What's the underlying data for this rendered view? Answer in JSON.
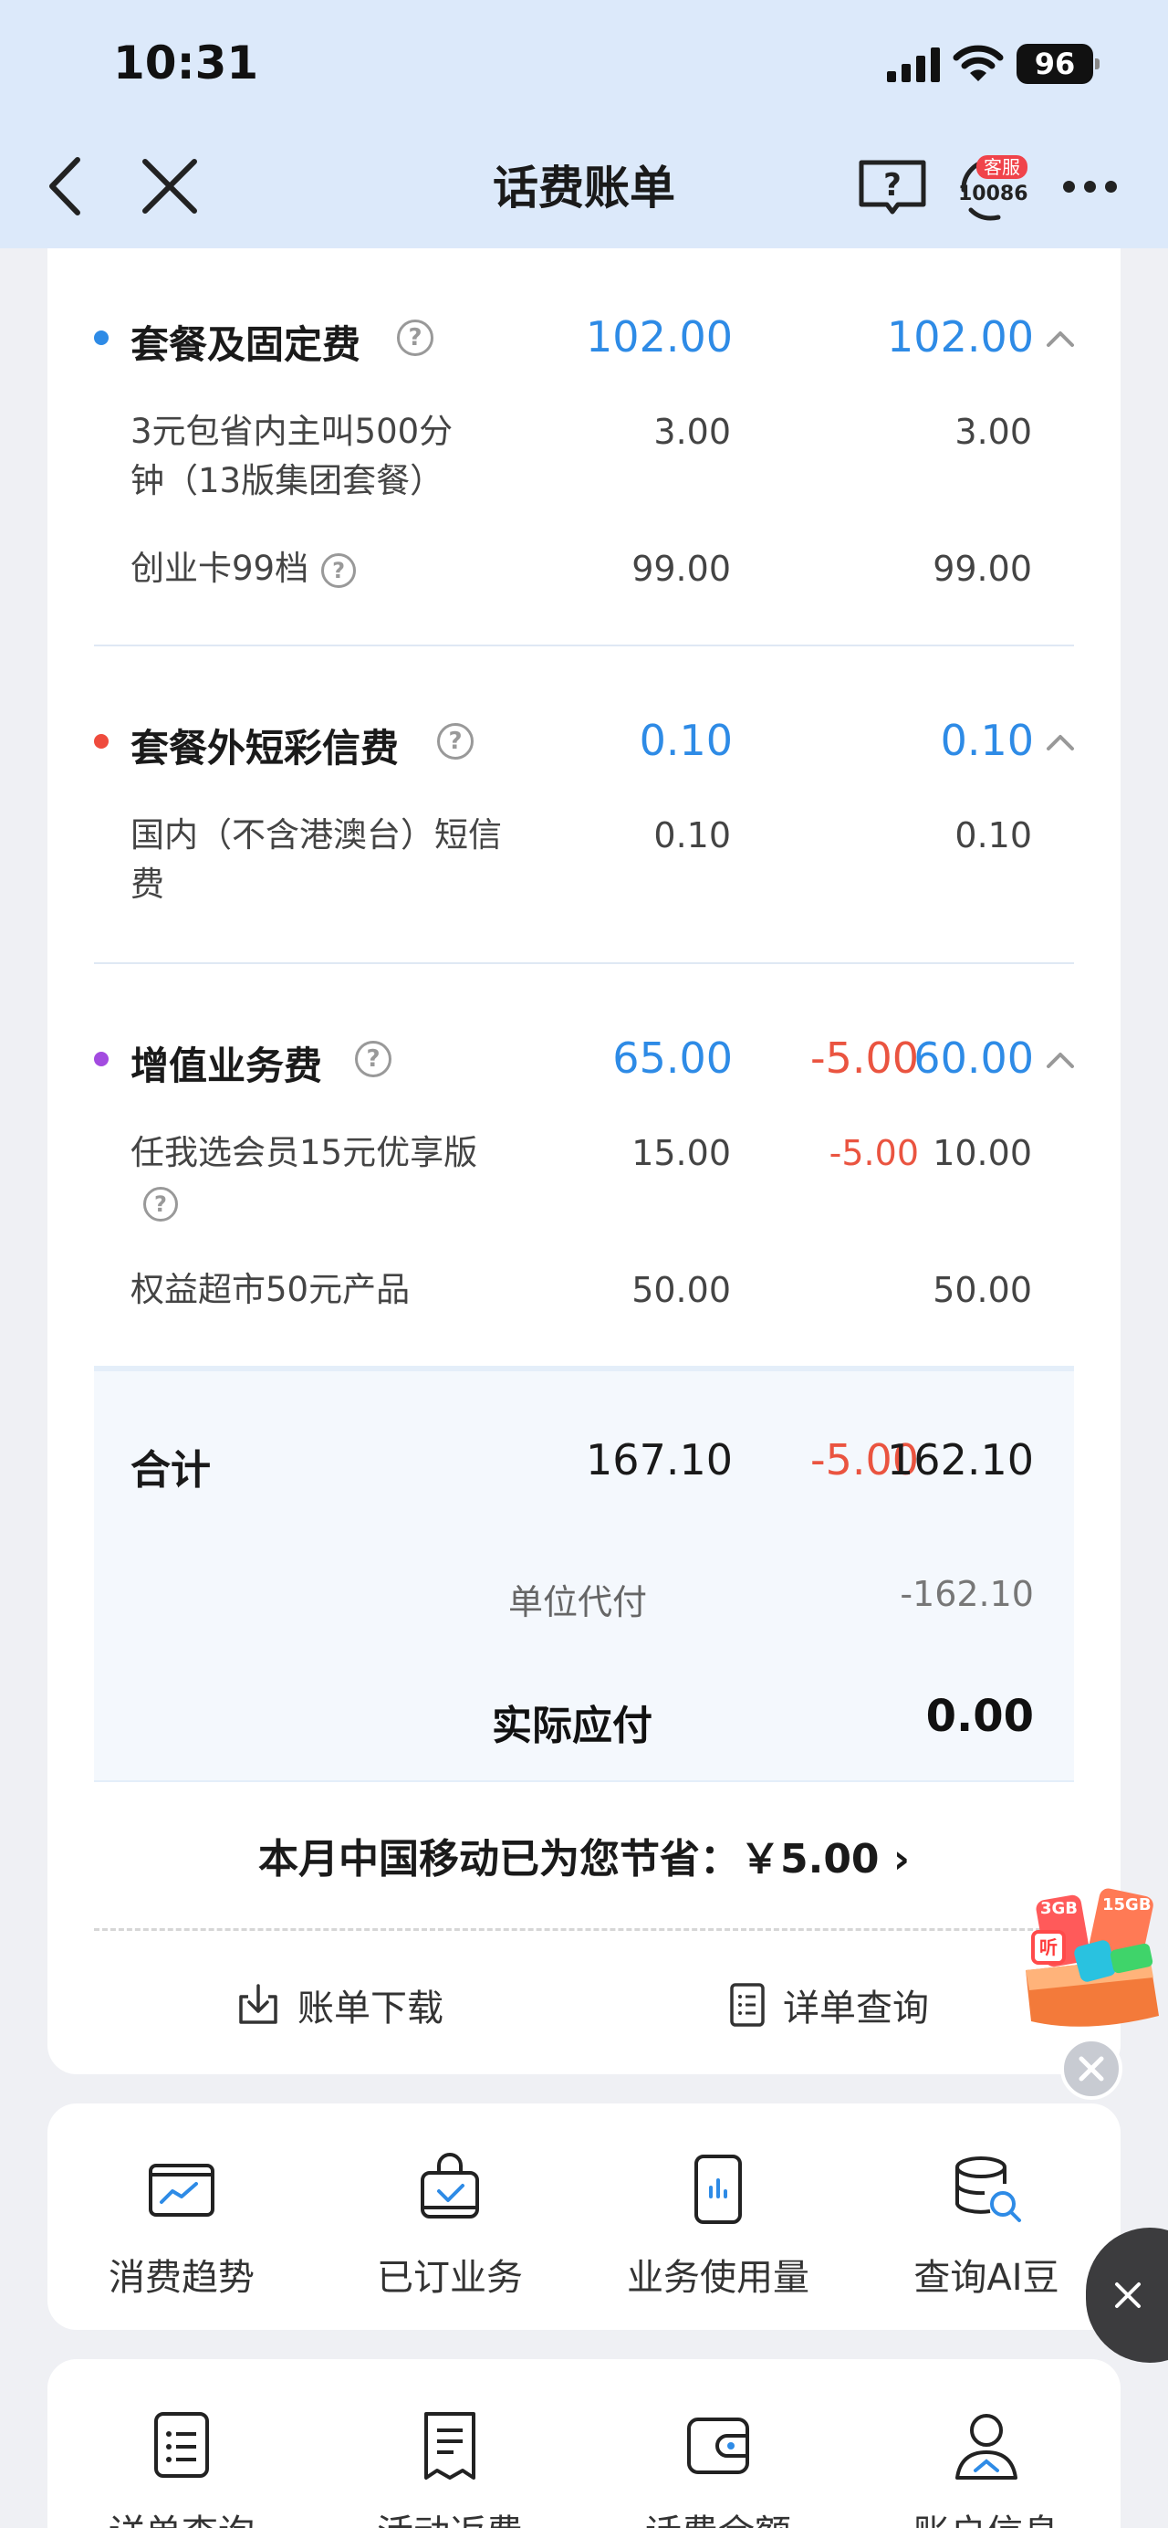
{
  "status_bar": {
    "time": "10:31",
    "battery": "96"
  },
  "nav": {
    "title": "话费账单",
    "service_badge": "客服",
    "service_number": "10086"
  },
  "bill": {
    "sections": [
      {
        "name": "套餐及固定费",
        "color": "#2e8be6",
        "amount": "102.00",
        "discount": "",
        "actual": "102.00",
        "items": [
          {
            "name": "3元包省内主叫500分钟（13版集团套餐）",
            "amount": "3.00",
            "discount": "",
            "actual": "3.00"
          },
          {
            "name": "创业卡99档",
            "amount": "99.00",
            "discount": "",
            "actual": "99.00"
          }
        ]
      },
      {
        "name": "套餐外短彩信费",
        "color": "#ef4b3d",
        "amount": "0.10",
        "discount": "",
        "actual": "0.10",
        "items": [
          {
            "name": "国内（不含港澳台）短信费",
            "amount": "0.10",
            "discount": "",
            "actual": "0.10"
          }
        ]
      },
      {
        "name": "增值业务费",
        "color": "#a34be0",
        "amount": "65.00",
        "discount": "-5.00",
        "actual": "60.00",
        "items": [
          {
            "name": "任我选会员15元优享版",
            "amount": "15.00",
            "discount": "-5.00",
            "actual": "10.00"
          },
          {
            "name": "权益超市50元产品",
            "amount": "50.00",
            "discount": "",
            "actual": "50.00"
          }
        ]
      }
    ],
    "total": {
      "label": "合计",
      "amount": "167.10",
      "discount": "-5.00",
      "actual": "162.10",
      "company_pay_label": "单位代付",
      "company_pay_amount": "-162.10",
      "actual_due_label": "实际应付",
      "actual_due_amount": "0.00"
    },
    "savings_text": "本月中国移动已为您节省：￥5.00 ›",
    "actions": {
      "download": "账单下载",
      "detail": "详单查询"
    }
  },
  "promo": {
    "tag_3gb": "3GB",
    "tag_15gb": "15GB"
  },
  "shortcuts_row1": [
    {
      "label": "消费趋势",
      "icon": "trend-icon"
    },
    {
      "label": "已订业务",
      "icon": "subscribed-icon"
    },
    {
      "label": "业务使用量",
      "icon": "usage-icon"
    },
    {
      "label": "查询AI豆",
      "icon": "ai-bean-icon"
    }
  ],
  "shortcuts_row2": [
    {
      "label": "详单查询",
      "icon": "list-icon"
    },
    {
      "label": "活动返费",
      "icon": "receipt-icon"
    },
    {
      "label": "话费余额",
      "icon": "wallet-icon"
    },
    {
      "label": "账户信息",
      "icon": "user-icon"
    }
  ]
}
